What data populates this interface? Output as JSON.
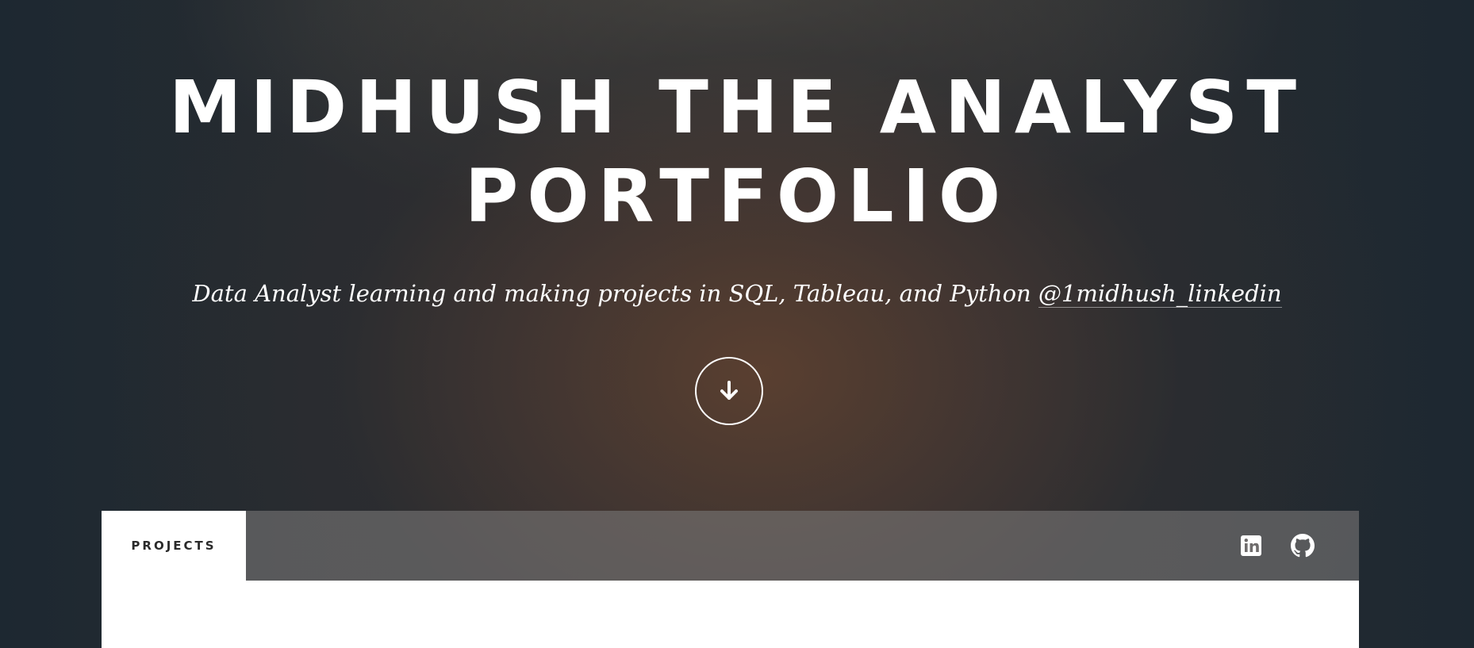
{
  "hero": {
    "title_line1": "MIDHUSH THE ANALYST",
    "title_line2": "PORTFOLIO",
    "subtitle_text": "Data Analyst learning and making projects in SQL, Tableau, and Python ",
    "subtitle_link": "@1midhush_linkedin",
    "scroll_icon": "arrow-down-icon"
  },
  "nav": {
    "tab_projects": "PROJECTS",
    "icons": [
      "linkedin-icon",
      "github-icon"
    ]
  },
  "colors": {
    "text": "#ffffff",
    "tab_bg": "#ffffff",
    "tab_text": "#2a2a2a"
  }
}
